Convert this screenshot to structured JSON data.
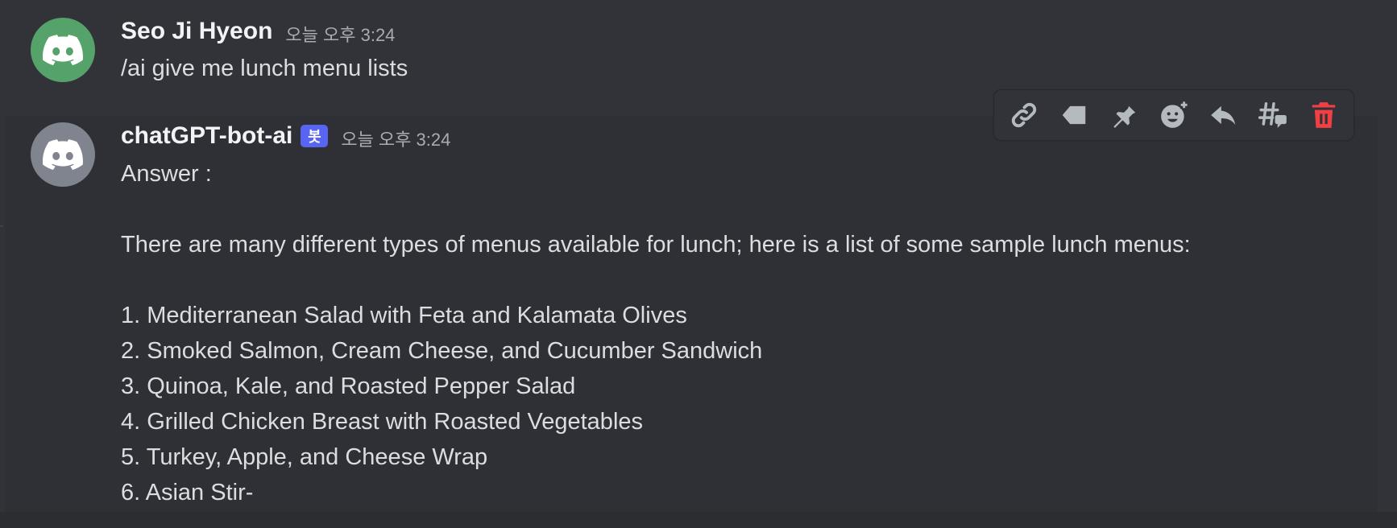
{
  "messages": [
    {
      "author": "Seo Ji Hyeon",
      "timestamp": "오늘 오후 3:24",
      "avatar_color": "#55a26a",
      "avatar_icon": "discord-logo-icon",
      "content": "/ai give me lunch menu lists"
    },
    {
      "author": "chatGPT-bot-ai",
      "bot_tag": "봇",
      "timestamp": "오늘 오후 3:24",
      "avatar_color": "#80848e",
      "avatar_icon": "discord-logo-icon",
      "content": "Answer :\n\nThere are many different types of menus available for lunch; here is a list of some sample lunch menus:\n\n1. Mediterranean Salad with Feta and Kalamata Olives\n2. Smoked Salmon, Cream Cheese, and Cucumber Sandwich\n3. Quinoa, Kale, and Roasted Pepper Salad\n4. Grilled Chicken Breast with Roasted Vegetables\n5. Turkey, Apple, and Cheese Wrap\n6. Asian Stir-"
    }
  ],
  "toolbar": {
    "buttons": [
      {
        "name": "copy-link",
        "icon": "link-icon"
      },
      {
        "name": "mark-unread",
        "icon": "bookmark-tag-icon"
      },
      {
        "name": "pin-message",
        "icon": "pin-icon"
      },
      {
        "name": "add-reaction",
        "icon": "add-reaction-icon"
      },
      {
        "name": "reply",
        "icon": "reply-arrow-icon"
      },
      {
        "name": "create-thread",
        "icon": "thread-icon"
      },
      {
        "name": "delete-message",
        "icon": "trash-icon"
      }
    ],
    "delete_color": "#f23f43",
    "icon_color": "#b5bac1"
  },
  "colors": {
    "background": "#313338",
    "hover_background": "#2e3035",
    "bot_tag": "#5865f2"
  }
}
